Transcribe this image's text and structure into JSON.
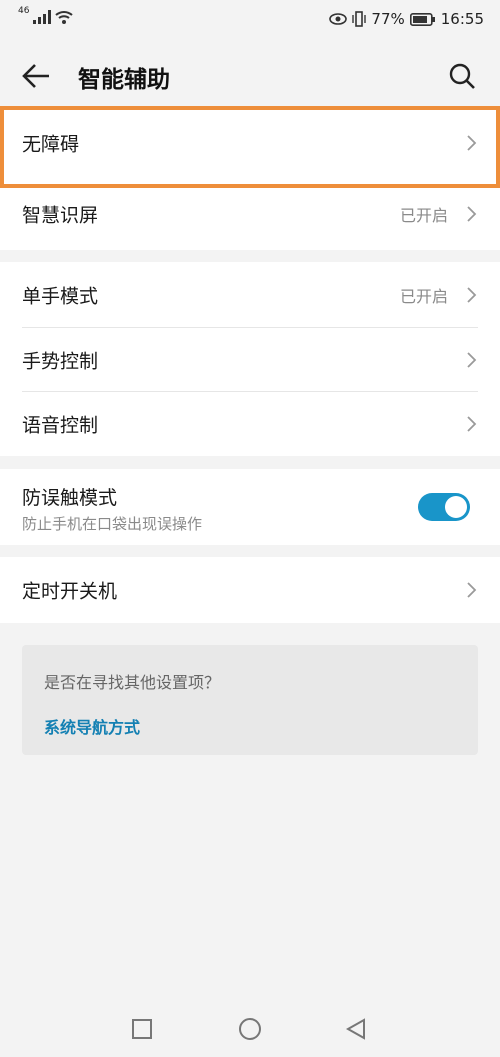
{
  "status_bar": {
    "network": "46",
    "battery": "77%",
    "time": "16:55"
  },
  "header": {
    "title": "智能辅助"
  },
  "group1": [
    {
      "label": "无障碍",
      "value": ""
    },
    {
      "label": "智慧识屏",
      "value": "已开启"
    }
  ],
  "group2": [
    {
      "label": "单手模式",
      "value": "已开启"
    },
    {
      "label": "手势控制",
      "value": ""
    },
    {
      "label": "语音控制",
      "value": ""
    }
  ],
  "group3": {
    "label": "防误触模式",
    "sub": "防止手机在口袋出现误操作",
    "toggle_on": true
  },
  "group4": [
    {
      "label": "定时开关机",
      "value": ""
    }
  ],
  "suggest": {
    "question": "是否在寻找其他设置项？",
    "link": "系统导航方式"
  },
  "colors": {
    "accent": "#1995c9",
    "highlight": "#ee8e3a",
    "link": "#1480b3"
  }
}
